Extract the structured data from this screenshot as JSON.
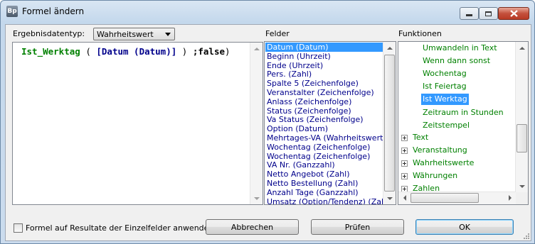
{
  "window": {
    "title": "Formel ändern",
    "app_icon_text": "Bp"
  },
  "formula_panel": {
    "result_type_label": "Ergebnisdatentyp:",
    "result_type_value": "Wahrheitswert",
    "formula": {
      "func": "Ist_Werktag",
      "open_paren": " ( ",
      "argument": "[Datum (Datum)]",
      "close_paren": " ) ",
      "separator": ";",
      "literal": "false",
      "end_paren": ")"
    }
  },
  "fields_panel": {
    "header": "Felder",
    "items": [
      "Datum (Datum)",
      "Beginn (Uhrzeit)",
      "Ende (Uhrzeit)",
      "Pers. (Zahl)",
      "Spalte 5 (Zeichenfolge)",
      "Veranstalter (Zeichenfolge)",
      "Anlass (Zeichenfolge)",
      "Status (Zeichenfolge)",
      "Va Status (Zeichenfolge)",
      "Option (Datum)",
      "Mehrtages-VA (Wahrheitswert)",
      "Wochentag (Zeichenfolge)",
      "Wochentag (Zeichenfolge)",
      "VA Nr. (Ganzzahl)",
      "Netto Angebot (Zahl)",
      "Netto Bestellung (Zahl)",
      "Anzahl Tage (Ganzzahl)",
      "Umsatz (Option/Tendenz) (Zahl)"
    ],
    "selected_index": 0
  },
  "functions_panel": {
    "header": "Funktionen",
    "children": [
      "Umwandeln in Text",
      "Wenn dann sonst",
      "Wochentag",
      "Ist Feiertag",
      "Ist Werktag",
      "Zeitraum in Stunden",
      "Zeitstempel"
    ],
    "selected_child_index": 4,
    "groups": [
      "Text",
      "Veranstaltung",
      "Wahrheitswerte",
      "Währungen",
      "Zahlen"
    ]
  },
  "footer": {
    "apply_checkbox_label": "Formel auf Resultate der Einzelfelder anwenden",
    "apply_checked": false,
    "cancel_label": "Abbrechen",
    "check_label": "Prüfen",
    "ok_label": "OK"
  },
  "colors": {
    "formula_function": "#008000",
    "formula_field": "#00008b",
    "list_text": "#00008b",
    "tree_text": "#008000",
    "selection": "#3399ff"
  }
}
